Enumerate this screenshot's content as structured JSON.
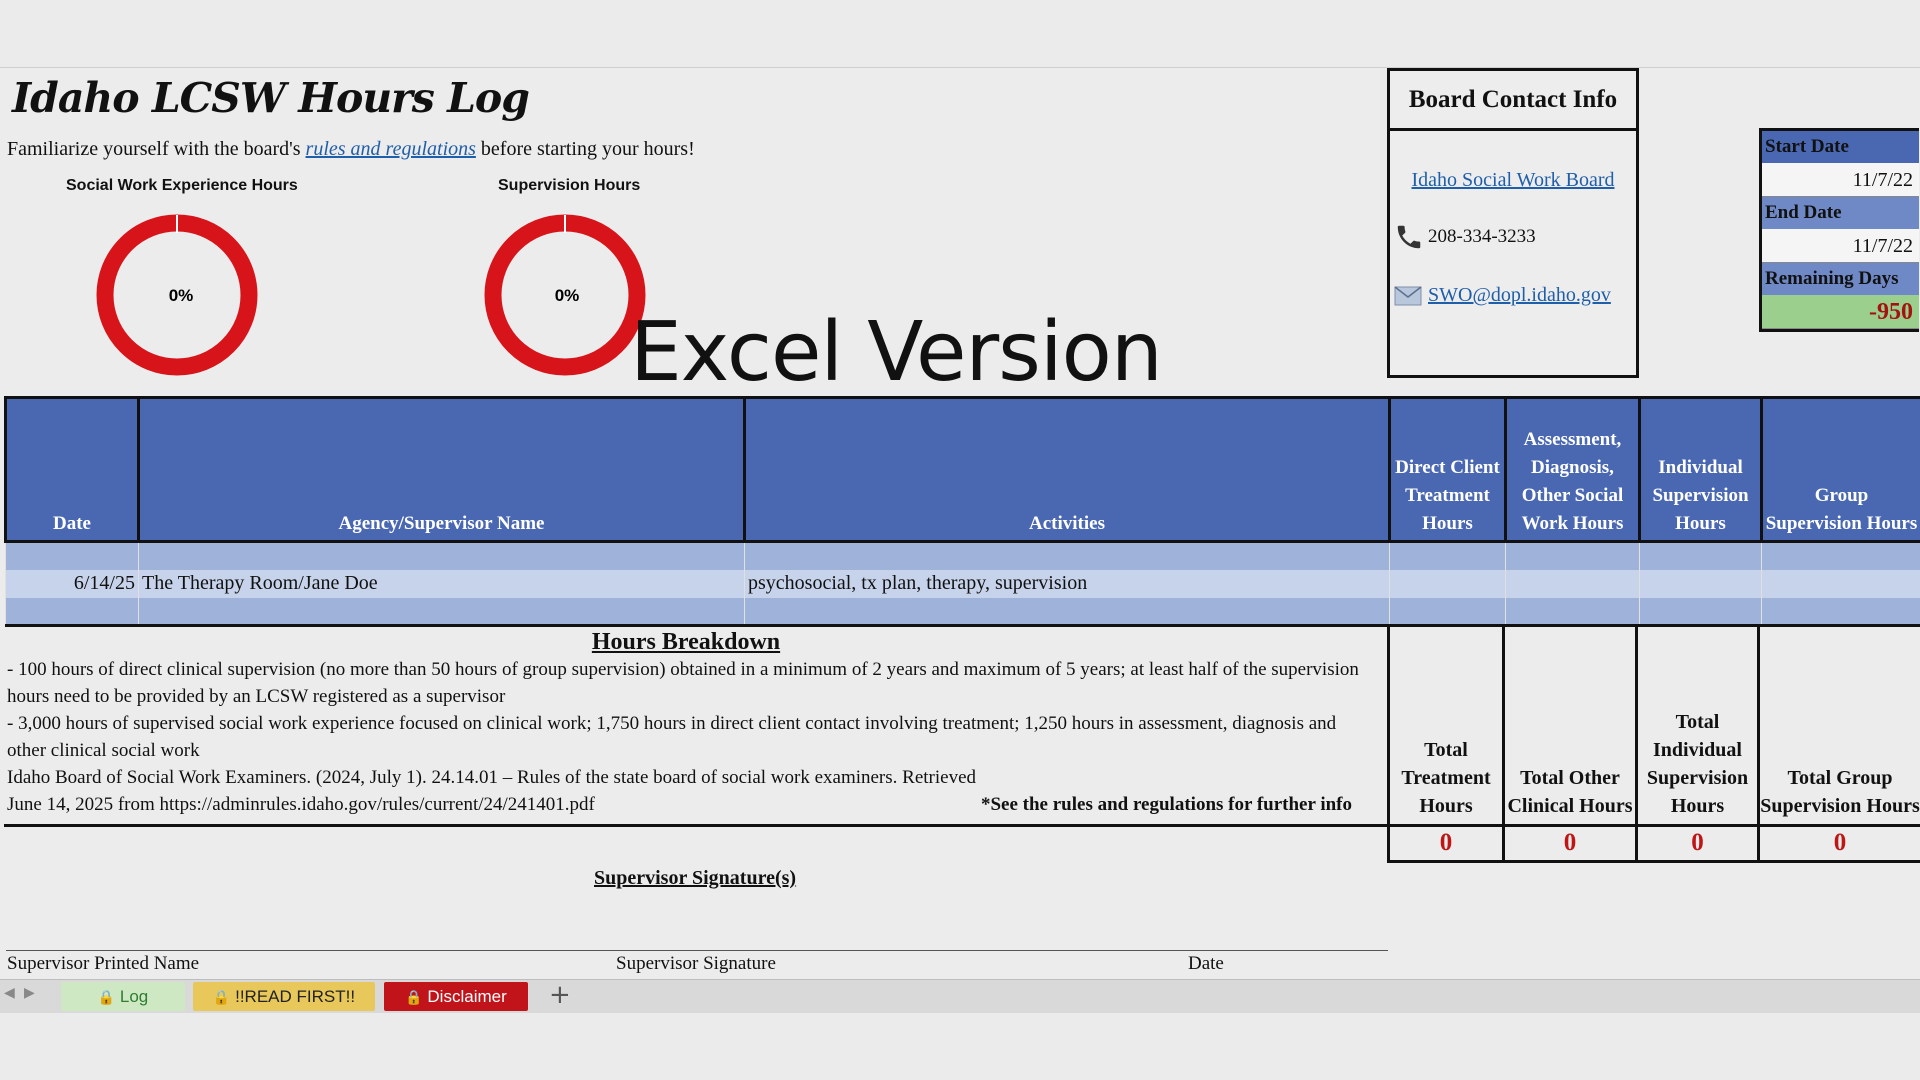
{
  "title": "Idaho LCSW Hours Log",
  "intro": {
    "before": "Familiarize yourself with the board's ",
    "link": "rules and regulations",
    "after": " before starting your hours!"
  },
  "donuts": [
    {
      "label": "Social Work Experience Hours",
      "value_text": "0%",
      "progress": 0
    },
    {
      "label": "Supervision Hours",
      "value_text": "0%",
      "progress": 0
    }
  ],
  "overlay_text": "Excel Version",
  "contact": {
    "title": "Board Contact Info",
    "board_link": "Idaho Social Work Board",
    "phone": "208-334-3233",
    "email": "SWO@dopl.idaho.gov"
  },
  "dates": {
    "start_label": "Start Date",
    "start_value": "11/7/22",
    "end_label": "End Date",
    "end_value": "11/7/22",
    "remaining_label": "Remaining Days",
    "remaining_value": "-950"
  },
  "table": {
    "headers": [
      "Date",
      "Agency/Supervisor Name",
      "Activities",
      "Direct Client Treatment Hours",
      "Assessment, Diagnosis, Other Social Work Hours",
      "Individual Supervision Hours",
      "Group Supervision Hours"
    ],
    "rows": [
      [
        "",
        "",
        "",
        "",
        "",
        "",
        ""
      ],
      [
        "6/14/25",
        "The Therapy Room/Jane Doe",
        "psychosocial, tx plan, therapy, supervision",
        "",
        "",
        "",
        ""
      ],
      [
        "",
        "",
        "",
        "",
        "",
        "",
        ""
      ]
    ]
  },
  "breakdown": {
    "title": "Hours Breakdown",
    "line1": "- 100 hours of direct clinical supervision (no more than 50 hours of group supervision) obtained in a minimum of 2 years and maximum of 5 years; at least half of the supervision hours need to be provided by an LCSW registered as a supervisor",
    "line2": "- 3,000 hours of supervised social work experience focused on clinical work; 1,750 hours in direct client contact involving treatment; 1,250 hours in assessment, diagnosis and other clinical social work",
    "line3": "Idaho Board of Social Work Examiners. (2024, July 1). 24.14.01 – Rules of the state board of social work examiners. Retrieved",
    "line4": "June 14, 2025 from https://adminrules.idaho.gov/rules/current/24/241401.pdf",
    "note": "*See the rules and regulations for further info"
  },
  "totals": {
    "labels": [
      "Total Treatment Hours",
      "Total Other Clinical Hours",
      "Total Individual Supervision Hours",
      "Total Group Supervision Hours"
    ],
    "values": [
      "0",
      "0",
      "0",
      "0"
    ]
  },
  "signature": {
    "title": "Supervisor Signature(s)",
    "printed_name": "Supervisor Printed Name",
    "signature": "Supervisor Signature",
    "date": "Date"
  },
  "tabs": [
    {
      "label": "Log",
      "color": "#cfe8c4",
      "text_color": "#2e7d32"
    },
    {
      "label": "!!READ FIRST!!",
      "color": "#e8c85a",
      "text_color": "#222"
    },
    {
      "label": "Disclaimer",
      "color": "#c0141a",
      "text_color": "#ffffff"
    }
  ],
  "add_sheet": "+",
  "colors": {
    "header_blue": "#4a68b2",
    "ring_red": "#d7141a",
    "total_red": "#c01515",
    "remaining_green": "#9bcf8d"
  }
}
